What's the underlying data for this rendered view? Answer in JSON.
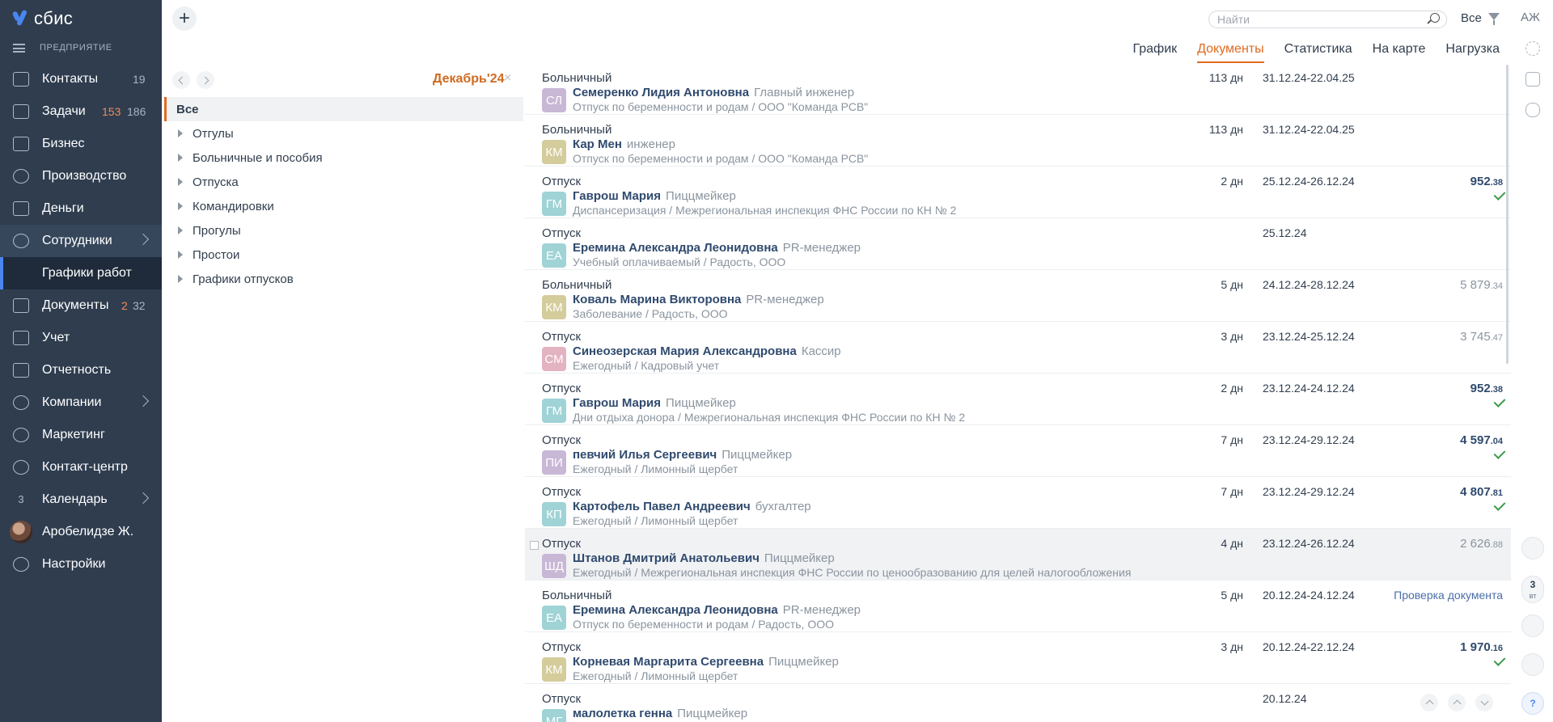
{
  "app": {
    "logo": "сбис",
    "org": "ПРЕДПРИЯТИЕ"
  },
  "sidebar": {
    "items": [
      {
        "label": "Контакты",
        "count": "19"
      },
      {
        "label": "Задачи",
        "count_red": "153",
        "count": "186"
      },
      {
        "label": "Бизнес"
      },
      {
        "label": "Производство"
      },
      {
        "label": "Деньги"
      },
      {
        "label": "Сотрудники"
      },
      {
        "label": "Графики работ"
      },
      {
        "label": "Документы",
        "count_red": "2",
        "count": "32"
      },
      {
        "label": "Учет"
      },
      {
        "label": "Отчетность"
      },
      {
        "label": "Компании"
      },
      {
        "label": "Маркетинг"
      },
      {
        "label": "Контакт-центр"
      },
      {
        "label": "Календарь",
        "day": "3"
      },
      {
        "label": "Аробелидзе Ж."
      },
      {
        "label": "Настройки"
      }
    ]
  },
  "topbar": {
    "add": "+",
    "search_placeholder": "Найти",
    "filter": "Все",
    "user": "АЖ"
  },
  "tabs": [
    "График",
    "Документы",
    "Статистика",
    "На карте",
    "Нагрузка"
  ],
  "active_tab": "Документы",
  "folders": {
    "period": "Декабрь'24",
    "close": "×",
    "items": [
      "Все",
      "Отгулы",
      "Больничные и пособия",
      "Отпуска",
      "Командировки",
      "Прогулы",
      "Простои",
      "Графики отпусков"
    ]
  },
  "day_pill": {
    "day": "3",
    "weekday": "вт"
  },
  "help": "?",
  "colors": {
    "accent": "#e06a1f",
    "sidebar": "#2f3d4f",
    "link": "#2f4a6e",
    "check": "#3a9a4a"
  },
  "rows": [
    {
      "type": "Больничный",
      "initials": "СЛ",
      "av": "#c9b7d6",
      "name": "Семеренко Лидия Антоновна",
      "role": "Главный инженер",
      "sub": "Отпуск по беременности и родам / ООО \"Команда РСВ\"",
      "days": "113 дн",
      "dates": "31.12.24-22.04.25"
    },
    {
      "type": "Больничный",
      "initials": "КМ",
      "av": "#d4cc9b",
      "name": "Кар Мен",
      "role": "инженер",
      "sub": "Отпуск по беременности и родам / ООО \"Команда РСВ\"",
      "days": "113 дн",
      "dates": "31.12.24-22.04.25"
    },
    {
      "type": "Отпуск",
      "initials": "ГМ",
      "av": "#9fd3d6",
      "name": "Гаврош Мария",
      "role": "Пиццмейкер",
      "sub": "Диспансеризация / Межрегиональная инспекция ФНС России по КН № 2",
      "days": "2 дн",
      "dates": "25.12.24-26.12.24",
      "amount": "952",
      "cents": ".38",
      "check": true
    },
    {
      "type": "Отпуск",
      "initials": "ЕА",
      "av": "#9fd3d6",
      "name": "Еремина Александра Леонидовна",
      "role": "PR-менеджер",
      "sub": "Учебный оплачиваемый / Радость, ООО",
      "dates": "25.12.24"
    },
    {
      "type": "Больничный",
      "initials": "КМ",
      "av": "#d4cc9b",
      "name": "Коваль Марина Викторовна",
      "role": "PR-менеджер",
      "sub": "Заболевание / Радость, ООО",
      "days": "5 дн",
      "dates": "24.12.24-28.12.24",
      "amount": "5 879",
      "cents": ".34",
      "gray": true
    },
    {
      "type": "Отпуск",
      "initials": "СМ",
      "av": "#e3b3c2",
      "name": "Синеозерская Мария Александровна",
      "role": "Кассир",
      "sub": "Ежегодный / Кадровый учет",
      "days": "3 дн",
      "dates": "23.12.24-25.12.24",
      "amount": "3 745",
      "cents": ".47",
      "gray": true
    },
    {
      "type": "Отпуск",
      "initials": "ГМ",
      "av": "#9fd3d6",
      "name": "Гаврош Мария",
      "role": "Пиццмейкер",
      "sub": "Дни отдыха донора / Межрегиональная инспекция ФНС России по КН № 2",
      "days": "2 дн",
      "dates": "23.12.24-24.12.24",
      "amount": "952",
      "cents": ".38",
      "check": true
    },
    {
      "type": "Отпуск",
      "initials": "ПИ",
      "av": "#c9b7d6",
      "name": "певчий Илья Сергеевич",
      "role": "Пиццмейкер",
      "sub": "Ежегодный / Лимонный щербет",
      "days": "7 дн",
      "dates": "23.12.24-29.12.24",
      "amount": "4 597",
      "cents": ".04",
      "check": true
    },
    {
      "type": "Отпуск",
      "initials": "КП",
      "av": "#9fd3d6",
      "name": "Картофель Павел Андреевич",
      "role": "бухгалтер",
      "sub": "Ежегодный / Лимонный щербет",
      "days": "7 дн",
      "dates": "23.12.24-29.12.24",
      "amount": "4 807",
      "cents": ".81",
      "check": true
    },
    {
      "type": "Отпуск",
      "initials": "ШД",
      "av": "#c9b7d6",
      "name": "Штанов Дмитрий Анатольевич",
      "role": "Пиццмейкер",
      "sub": "Ежегодный / Межрегиональная инспекция ФНС России по ценообразованию для целей налогообложения",
      "days": "4 дн",
      "dates": "23.12.24-26.12.24",
      "amount": "2 626",
      "cents": ".88",
      "gray": true,
      "highlight": true
    },
    {
      "type": "Больничный",
      "initials": "ЕА",
      "av": "#9fd3d6",
      "name": "Еремина Александра Леонидовна",
      "role": "PR-менеджер",
      "sub": "Отпуск по беременности и родам / Радость, ООО",
      "days": "5 дн",
      "dates": "20.12.24-24.12.24",
      "status": "Проверка документа"
    },
    {
      "type": "Отпуск",
      "initials": "КМ",
      "av": "#d4cc9b",
      "name": "Корневая Маргарита Сергеевна",
      "role": "Пиццмейкер",
      "sub": "Ежегодный / Лимонный щербет",
      "days": "3 дн",
      "dates": "20.12.24-22.12.24",
      "amount": "1 970",
      "cents": ".16",
      "check": true
    },
    {
      "type": "Отпуск",
      "initials": "МГ",
      "av": "#9fd3d6",
      "name": "малолетка генна",
      "role": "Пиццмейкер",
      "sub": "",
      "dates": "20.12.24"
    }
  ]
}
